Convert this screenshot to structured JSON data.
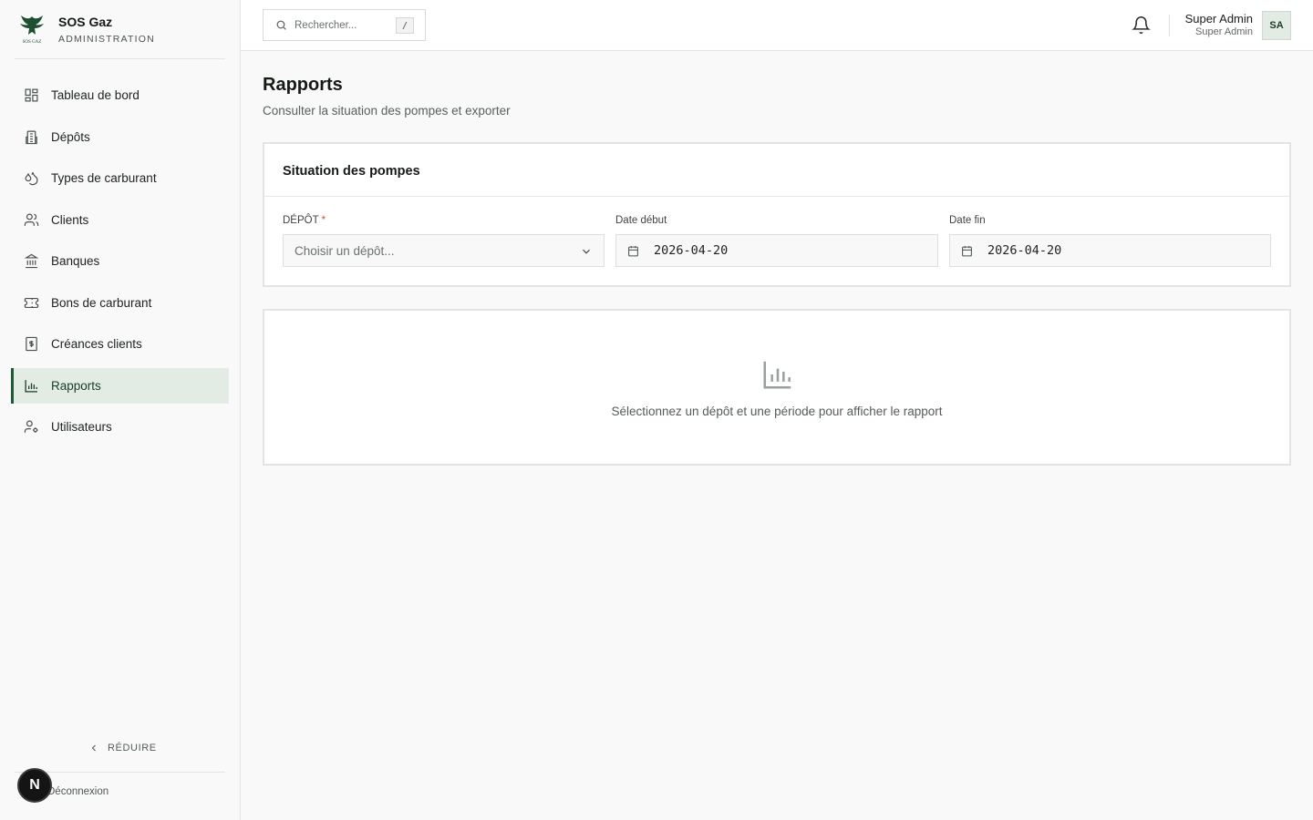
{
  "brand": {
    "name": "SOS Gaz",
    "subtitle": "ADMINISTRATION",
    "logo_text": "SOS GAZ"
  },
  "sidebar": {
    "items": [
      {
        "label": "Tableau de bord",
        "icon": "dashboard-icon",
        "active": false
      },
      {
        "label": "Dépôts",
        "icon": "building-icon",
        "active": false
      },
      {
        "label": "Types de carburant",
        "icon": "droplets-icon",
        "active": false
      },
      {
        "label": "Clients",
        "icon": "users-icon",
        "active": false
      },
      {
        "label": "Banques",
        "icon": "bank-icon",
        "active": false
      },
      {
        "label": "Bons de carburant",
        "icon": "ticket-icon",
        "active": false
      },
      {
        "label": "Créances clients",
        "icon": "receipt-dollar-icon",
        "active": false
      },
      {
        "label": "Rapports",
        "icon": "bar-chart-icon",
        "active": true
      },
      {
        "label": "Utilisateurs",
        "icon": "user-cog-icon",
        "active": false
      }
    ],
    "reduce_label": "RÉDUIRE",
    "logout_label": "Déconnexion",
    "badge_letter": "N"
  },
  "topbar": {
    "search_placeholder": "Rechercher...",
    "search_shortcut": "/",
    "user_name": "Super Admin",
    "user_role": "Super Admin",
    "avatar_initials": "SA"
  },
  "main": {
    "title": "Rapports",
    "subtitle": "Consulter la situation des pompes et exporter",
    "card": {
      "title": "Situation des pompes",
      "depot_label": "DÉPÔT",
      "depot_required": "*",
      "depot_placeholder": "Choisir un dépôt...",
      "date_start_label": "Date début",
      "date_start_value": "2026-04-20",
      "date_end_label": "Date fin",
      "date_end_value": "2026-04-20"
    },
    "empty_message": "Sélectionnez un dépôt et une période pour afficher le rapport"
  },
  "colors": {
    "accent": "#1f5a36",
    "active_bg": "#e3ebe5",
    "required": "#d44a3a"
  }
}
